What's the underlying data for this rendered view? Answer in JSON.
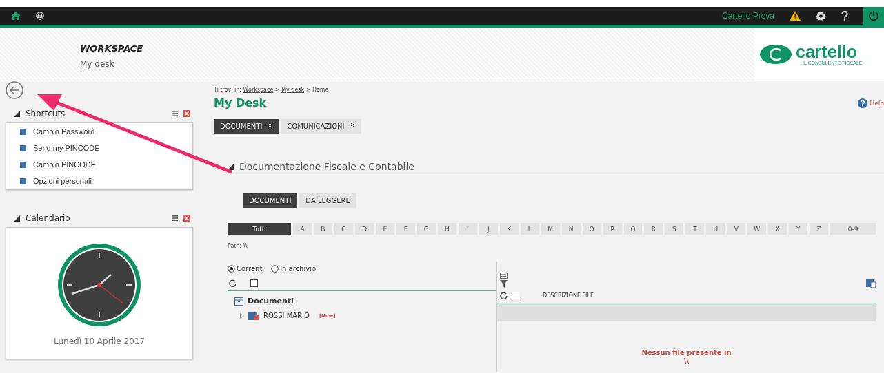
{
  "topbar": {
    "user": "Cartello Prova"
  },
  "header": {
    "title": "WORKSPACE",
    "subtitle": "My desk",
    "logo": {
      "name": "cartello",
      "tagline": "IL CONSULENTE FISCALE"
    }
  },
  "sidebar": {
    "panels": [
      {
        "kind": "list",
        "title": "Shortcuts",
        "items": [
          "Cambio Password",
          "Send my PINCODE",
          "Cambio PINCODE",
          "Opzioni personali"
        ]
      },
      {
        "kind": "clock",
        "title": "Calendario",
        "date": "Lunedì 10 Aprile 2017"
      }
    ]
  },
  "breadcrumb": {
    "prefix": "Ti trovi in:",
    "separator": ">",
    "items": [
      {
        "label": "Workspace",
        "kind": "link"
      },
      {
        "label": "My desk",
        "kind": "link"
      },
      {
        "label": "Home",
        "kind": "text"
      }
    ]
  },
  "page_title": "My Desk",
  "help": "Help",
  "tabs": [
    {
      "label": "DOCUMENTI",
      "selected": true
    },
    {
      "label": "COMUNICAZIONI",
      "selected": false
    }
  ],
  "section": {
    "title": "Documentazione Fiscale e Contabile"
  },
  "subtabs": [
    {
      "label": "DOCUMENTI",
      "selected": true
    },
    {
      "label": "DA LEGGERE",
      "selected": false
    }
  ],
  "letters": [
    {
      "label": "Tutti",
      "selected": true
    },
    {
      "label": "A",
      "selected": false
    },
    {
      "label": "B",
      "selected": false
    },
    {
      "label": "C",
      "selected": false
    },
    {
      "label": "D",
      "selected": false
    },
    {
      "label": "E",
      "selected": false
    },
    {
      "label": "F",
      "selected": false
    },
    {
      "label": "G",
      "selected": false
    },
    {
      "label": "H",
      "selected": false
    },
    {
      "label": "I",
      "selected": false
    },
    {
      "label": "J",
      "selected": false
    },
    {
      "label": "K",
      "selected": false
    },
    {
      "label": "L",
      "selected": false
    },
    {
      "label": "M",
      "selected": false
    },
    {
      "label": "N",
      "selected": false
    },
    {
      "label": "O",
      "selected": false
    },
    {
      "label": "P",
      "selected": false
    },
    {
      "label": "Q",
      "selected": false
    },
    {
      "label": "R",
      "selected": false
    },
    {
      "label": "S",
      "selected": false
    },
    {
      "label": "T",
      "selected": false
    },
    {
      "label": "U",
      "selected": false
    },
    {
      "label": "V",
      "selected": false
    },
    {
      "label": "W",
      "selected": false
    },
    {
      "label": "X",
      "selected": false
    },
    {
      "label": "Y",
      "selected": false
    },
    {
      "label": "Z",
      "selected": false
    },
    {
      "label": "0-9",
      "selected": false
    }
  ],
  "path": {
    "label": "Path:",
    "value": "\\\\"
  },
  "radios": [
    {
      "label": "Correnti",
      "selected": true
    },
    {
      "label": "In archivio",
      "selected": false
    }
  ],
  "select_all": [
    {
      "checked": false
    },
    {
      "checked": false
    }
  ],
  "tree": {
    "root": "Documenti",
    "children": [
      {
        "label": "ROSSI MARIO",
        "badge": "[New]",
        "expanded": false
      }
    ]
  },
  "files": {
    "columns": [
      "DESCRIZIONE FILE"
    ],
    "empty": "Nessun file presente in",
    "empty_path": "\\\\"
  }
}
